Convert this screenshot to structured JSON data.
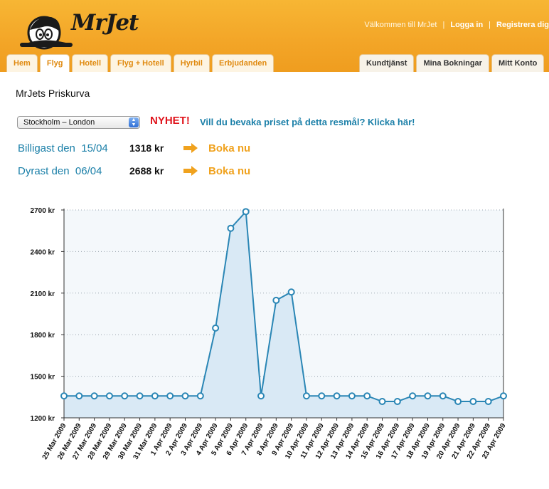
{
  "header": {
    "logo_text": "MrJet",
    "welcome": "Välkommen till MrJet",
    "login": "Logga in",
    "register": "Registrera dig"
  },
  "tabs_left": [
    "Hem",
    "Flyg",
    "Hotell",
    "Flyg + Hotell",
    "Hyrbil",
    "Erbjudanden"
  ],
  "tabs_right": [
    "Kundtjänst",
    "Mina Bokningar",
    "Mitt Konto"
  ],
  "active_tab": "Flyg",
  "page_title": "MrJets Priskurva",
  "route_select": {
    "value": "Stockholm – London"
  },
  "news": {
    "label": "NYHET!",
    "link": "Vill du bevaka priset på detta resmål? Klicka här!"
  },
  "cheapest": {
    "label_prefix": "Billigast den",
    "date": "15/04",
    "price": "1318 kr",
    "book": "Boka nu"
  },
  "dearest": {
    "label_prefix": "Dyrast den",
    "date": "06/04",
    "price": "2688 kr",
    "book": "Boka nu"
  },
  "colors": {
    "accent": "#f0a21e",
    "link": "#1a7fa8",
    "line": "#2a86b5",
    "fill": "#d9e9f5",
    "news": "#e0141c"
  },
  "chart_data": {
    "type": "area",
    "title": "",
    "xlabel": "",
    "ylabel": "",
    "ylim": [
      1200,
      2700
    ],
    "y_ticks": [
      1200,
      1500,
      1800,
      2100,
      2400,
      2700
    ],
    "y_tick_labels": [
      "1200 kr",
      "1500 kr",
      "1800 kr",
      "2100 kr",
      "2400 kr",
      "2700 kr"
    ],
    "grid": true,
    "x": [
      "25 Mar 2009",
      "26 Mar 2009",
      "27 Mar 2009",
      "28 Mar 2009",
      "29 Mar 2009",
      "30 Mar 2009",
      "31 Mar 2009",
      "1 Apr 2009",
      "2 Apr 2009",
      "3 Apr 2009",
      "4 Apr 2009",
      "5 Apr 2009",
      "6 Apr 2009",
      "7 Apr 2009",
      "8 Apr 2009",
      "9 Apr 2009",
      "10 Apr 2009",
      "11 Apr 2009",
      "12 Apr 2009",
      "13 Apr 2009",
      "14 Apr 2009",
      "15 Apr 2009",
      "16 Apr 2009",
      "17 Apr 2009",
      "18 Apr 2009",
      "19 Apr 2009",
      "20 Apr 2009",
      "21 Apr 2009",
      "22 Apr 2009",
      "23 Apr 2009"
    ],
    "values": [
      1358,
      1358,
      1358,
      1358,
      1358,
      1358,
      1358,
      1358,
      1358,
      1358,
      1848,
      2568,
      2688,
      1358,
      2048,
      2108,
      1358,
      1358,
      1358,
      1358,
      1358,
      1318,
      1318,
      1358,
      1358,
      1358,
      1318,
      1318,
      1318,
      1358
    ]
  }
}
